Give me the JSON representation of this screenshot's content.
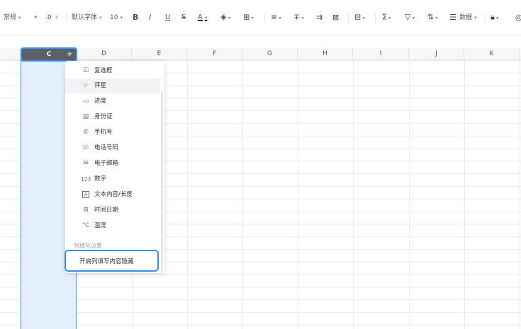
{
  "toolbar": {
    "format": "常规",
    "decimal": ".0",
    "font": "默认字体",
    "size": "10",
    "bold": "B",
    "italic": "I",
    "underline": "U",
    "strike": "S",
    "font_color": "A",
    "data_label": "数据"
  },
  "columns": {
    "selected": "C",
    "others": [
      "D",
      "E",
      "F",
      "G",
      "H",
      "I",
      "J",
      "K"
    ]
  },
  "menu": {
    "items": [
      {
        "icon": "checkbox-icon",
        "glyph": "☑",
        "label": "复选框"
      },
      {
        "icon": "star-icon",
        "glyph": "☆",
        "label": "评星"
      },
      {
        "icon": "progress-icon",
        "glyph": "▭",
        "label": "进度"
      },
      {
        "icon": "id-card-icon",
        "glyph": "▤",
        "label": "身份证"
      },
      {
        "icon": "phone-icon",
        "glyph": "✆",
        "label": "手机号"
      },
      {
        "icon": "telephone-icon",
        "glyph": "☏",
        "label": "电话号码"
      },
      {
        "icon": "mail-icon",
        "glyph": "✉",
        "label": "电子邮箱"
      },
      {
        "icon": "number-icon",
        "glyph": "123",
        "label": "数字"
      },
      {
        "icon": "text-icon",
        "glyph": "A",
        "label": "文本内容/长度"
      },
      {
        "icon": "datetime-icon",
        "glyph": "⊞",
        "label": "时间日期"
      },
      {
        "icon": "temperature-icon",
        "glyph": "°C",
        "label": "温度"
      }
    ],
    "section_title": "列填写设置",
    "action_label": "开启列填写内容隐藏"
  },
  "colors": {
    "accent": "#3a8ee6",
    "selected_column": "#e3f0fc",
    "header_dark": "#5c6067"
  }
}
